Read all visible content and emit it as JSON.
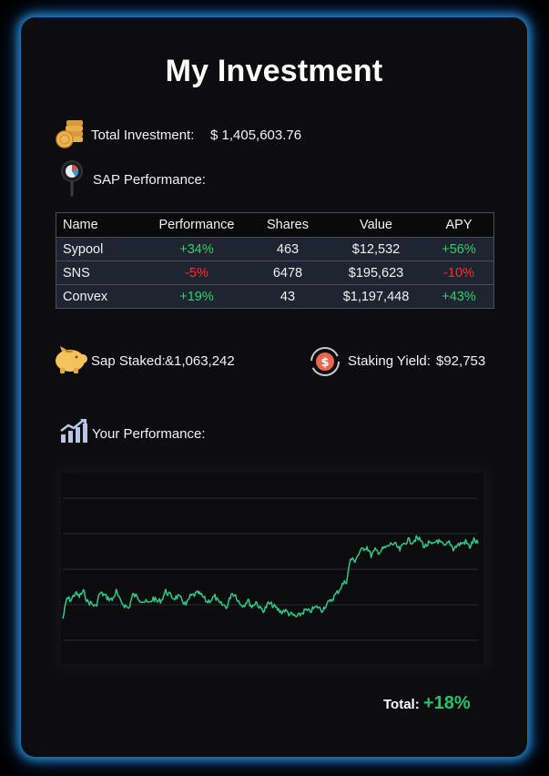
{
  "title": "My Investment",
  "total_investment": {
    "label": "Total Investment:",
    "value": "$ 1,405,603.76",
    "icon": "coins-icon"
  },
  "sap_performance": {
    "label": "SAP Performance:",
    "icon": "magnifier-chart-icon"
  },
  "table": {
    "headers": [
      "Name",
      "Performance",
      "Shares",
      "Value",
      "APY"
    ],
    "rows": [
      {
        "name": "Sypool",
        "performance": "+34%",
        "shares": "463",
        "value": "$12,532",
        "apy": "+56%"
      },
      {
        "name": "SNS",
        "performance": "-5%",
        "shares": "6478",
        "value": "$195,623",
        "apy": "-10%"
      },
      {
        "name": "Convex",
        "performance": "+19%",
        "shares": "43",
        "value": "$1,197,448",
        "apy": "+43%"
      }
    ]
  },
  "sap_staked": {
    "label": "Sap Staked:",
    "value": "&1,063,242",
    "icon": "piggy-bank-icon"
  },
  "staking_yield": {
    "label": "Staking Yield:",
    "value": "$92,753",
    "icon": "dollar-cycle-icon"
  },
  "your_performance": {
    "label": "Your Performance:",
    "icon": "growth-chart-icon"
  },
  "total": {
    "label": "Total:",
    "value": "+18%"
  },
  "colors": {
    "positive": "#2bd06c",
    "negative": "#ff2b2b",
    "line": "#2ec98a",
    "glow": "#2896e6"
  },
  "chart_data": {
    "type": "line",
    "grid": true,
    "series": [
      {
        "values": [
          20,
          32,
          31,
          35,
          33,
          36,
          30,
          29,
          27,
          35,
          34,
          32,
          31,
          36,
          30,
          28,
          26,
          34,
          33,
          31,
          30,
          29,
          32,
          30,
          31,
          36,
          34,
          32,
          33,
          31,
          28,
          33,
          34,
          35,
          33,
          30,
          31,
          33,
          29,
          28,
          27,
          35,
          34,
          29,
          28,
          31,
          27,
          30,
          26,
          25,
          29,
          28,
          26,
          24,
          25,
          23,
          22,
          21,
          23,
          25,
          24,
          26,
          27,
          25,
          28,
          30,
          33,
          36,
          40,
          42,
          55,
          54,
          58,
          61,
          62,
          57,
          60,
          59,
          61,
          62,
          64,
          63,
          60,
          64,
          66,
          65,
          67,
          66,
          62,
          64,
          63,
          66,
          64,
          62,
          65,
          61,
          63,
          64,
          65,
          62,
          66,
          64
        ]
      }
    ]
  }
}
